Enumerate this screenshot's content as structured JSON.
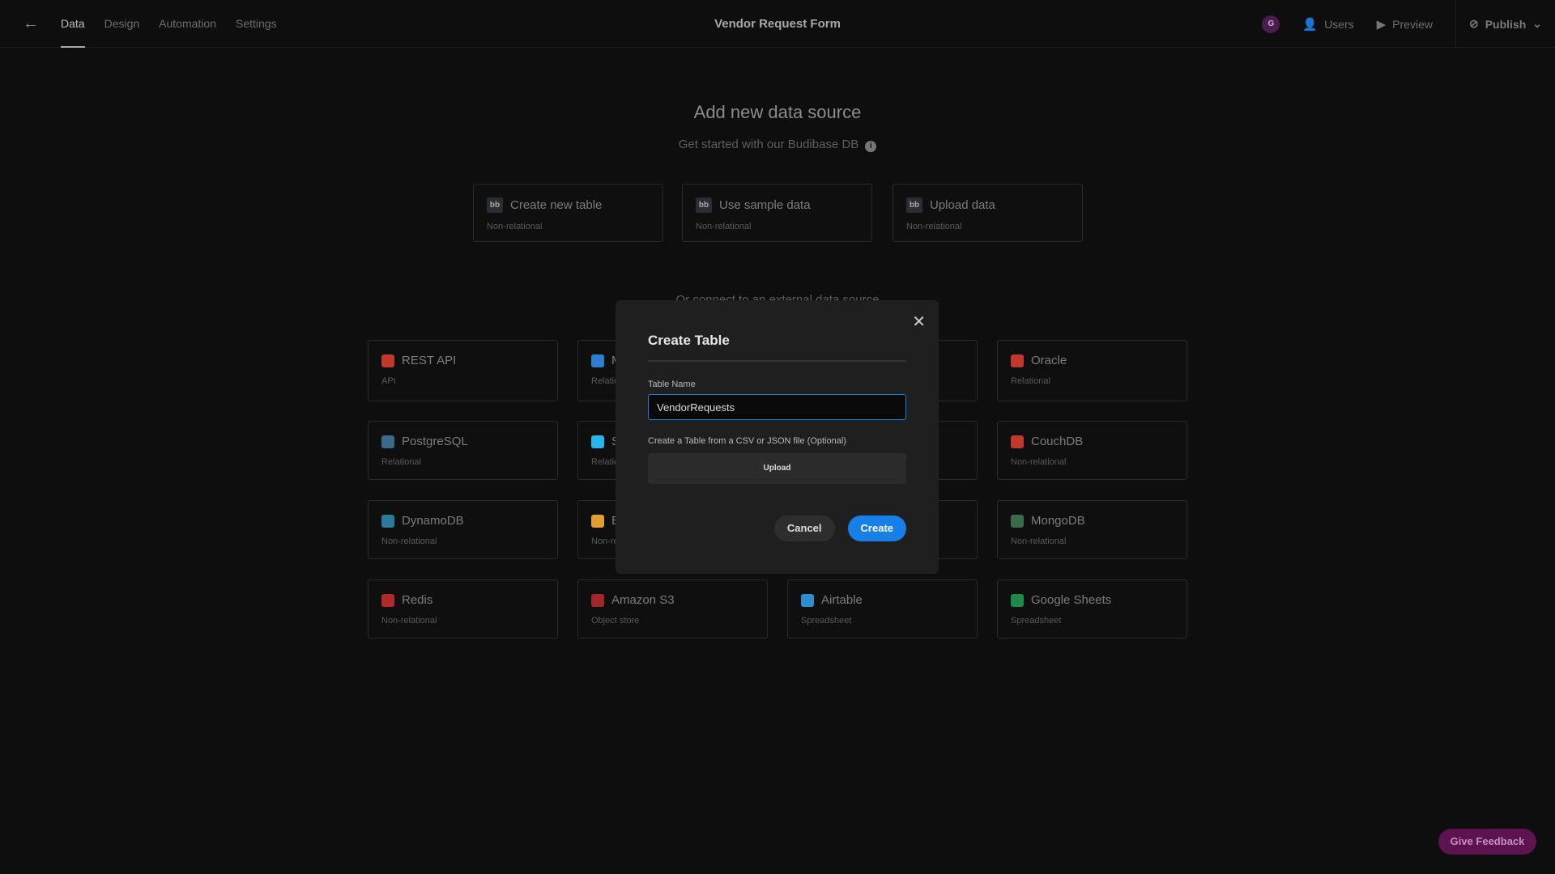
{
  "header": {
    "tabs": [
      {
        "label": "Data"
      },
      {
        "label": "Design"
      },
      {
        "label": "Automation"
      },
      {
        "label": "Settings"
      }
    ],
    "title": "Vendor Request Form",
    "avatar": "G",
    "users": "Users",
    "preview": "Preview",
    "publish": "Publish"
  },
  "main": {
    "title": "Add new data source",
    "subtitle": "Get started with our Budibase DB",
    "internal": [
      {
        "name": "Create new table",
        "type": "Non-relational"
      },
      {
        "name": "Use sample data",
        "type": "Non-relational"
      },
      {
        "name": "Upload data",
        "type": "Non-relational"
      }
    ],
    "external_heading": "Or connect to an external data source",
    "sources": [
      {
        "name": "REST API",
        "type": "API",
        "color": "#c0392b"
      },
      {
        "name": "MS SQL Server",
        "type": "Relational",
        "color": "#2d7dd2"
      },
      {
        "name": "",
        "type": "",
        "color": ""
      },
      {
        "name": "Oracle",
        "type": "Relational",
        "color": "#c0392b"
      },
      {
        "name": "PostgreSQL",
        "type": "Relational",
        "color": "#3a6a8a"
      },
      {
        "name": "Snowflake",
        "type": "Relational",
        "color": "#29b5e8"
      },
      {
        "name": "",
        "type": "",
        "color": ""
      },
      {
        "name": "CouchDB",
        "type": "Non-relational",
        "color": "#c0392b"
      },
      {
        "name": "DynamoDB",
        "type": "Non-relational",
        "color": "#2a7a9a"
      },
      {
        "name": "Elasticsearch",
        "type": "Non-relational",
        "color": "#e0a030"
      },
      {
        "name": "",
        "type": "",
        "color": ""
      },
      {
        "name": "MongoDB",
        "type": "Non-relational",
        "color": "#3a6a4a"
      },
      {
        "name": "Redis",
        "type": "Non-relational",
        "color": "#b02a2a"
      },
      {
        "name": "Amazon S3",
        "type": "Object store",
        "color": "#a02828"
      },
      {
        "name": "Airtable",
        "type": "Spreadsheet",
        "color": "#2d8fd2"
      },
      {
        "name": "Google Sheets",
        "type": "Spreadsheet",
        "color": "#1e8a4a"
      }
    ]
  },
  "modal": {
    "title": "Create Table",
    "table_name_label": "Table Name",
    "table_name_value": "VendorRequests",
    "file_label": "Create a Table from a CSV or JSON file (Optional)",
    "upload": "Upload",
    "cancel": "Cancel",
    "create": "Create"
  },
  "feedback": "Give Feedback"
}
